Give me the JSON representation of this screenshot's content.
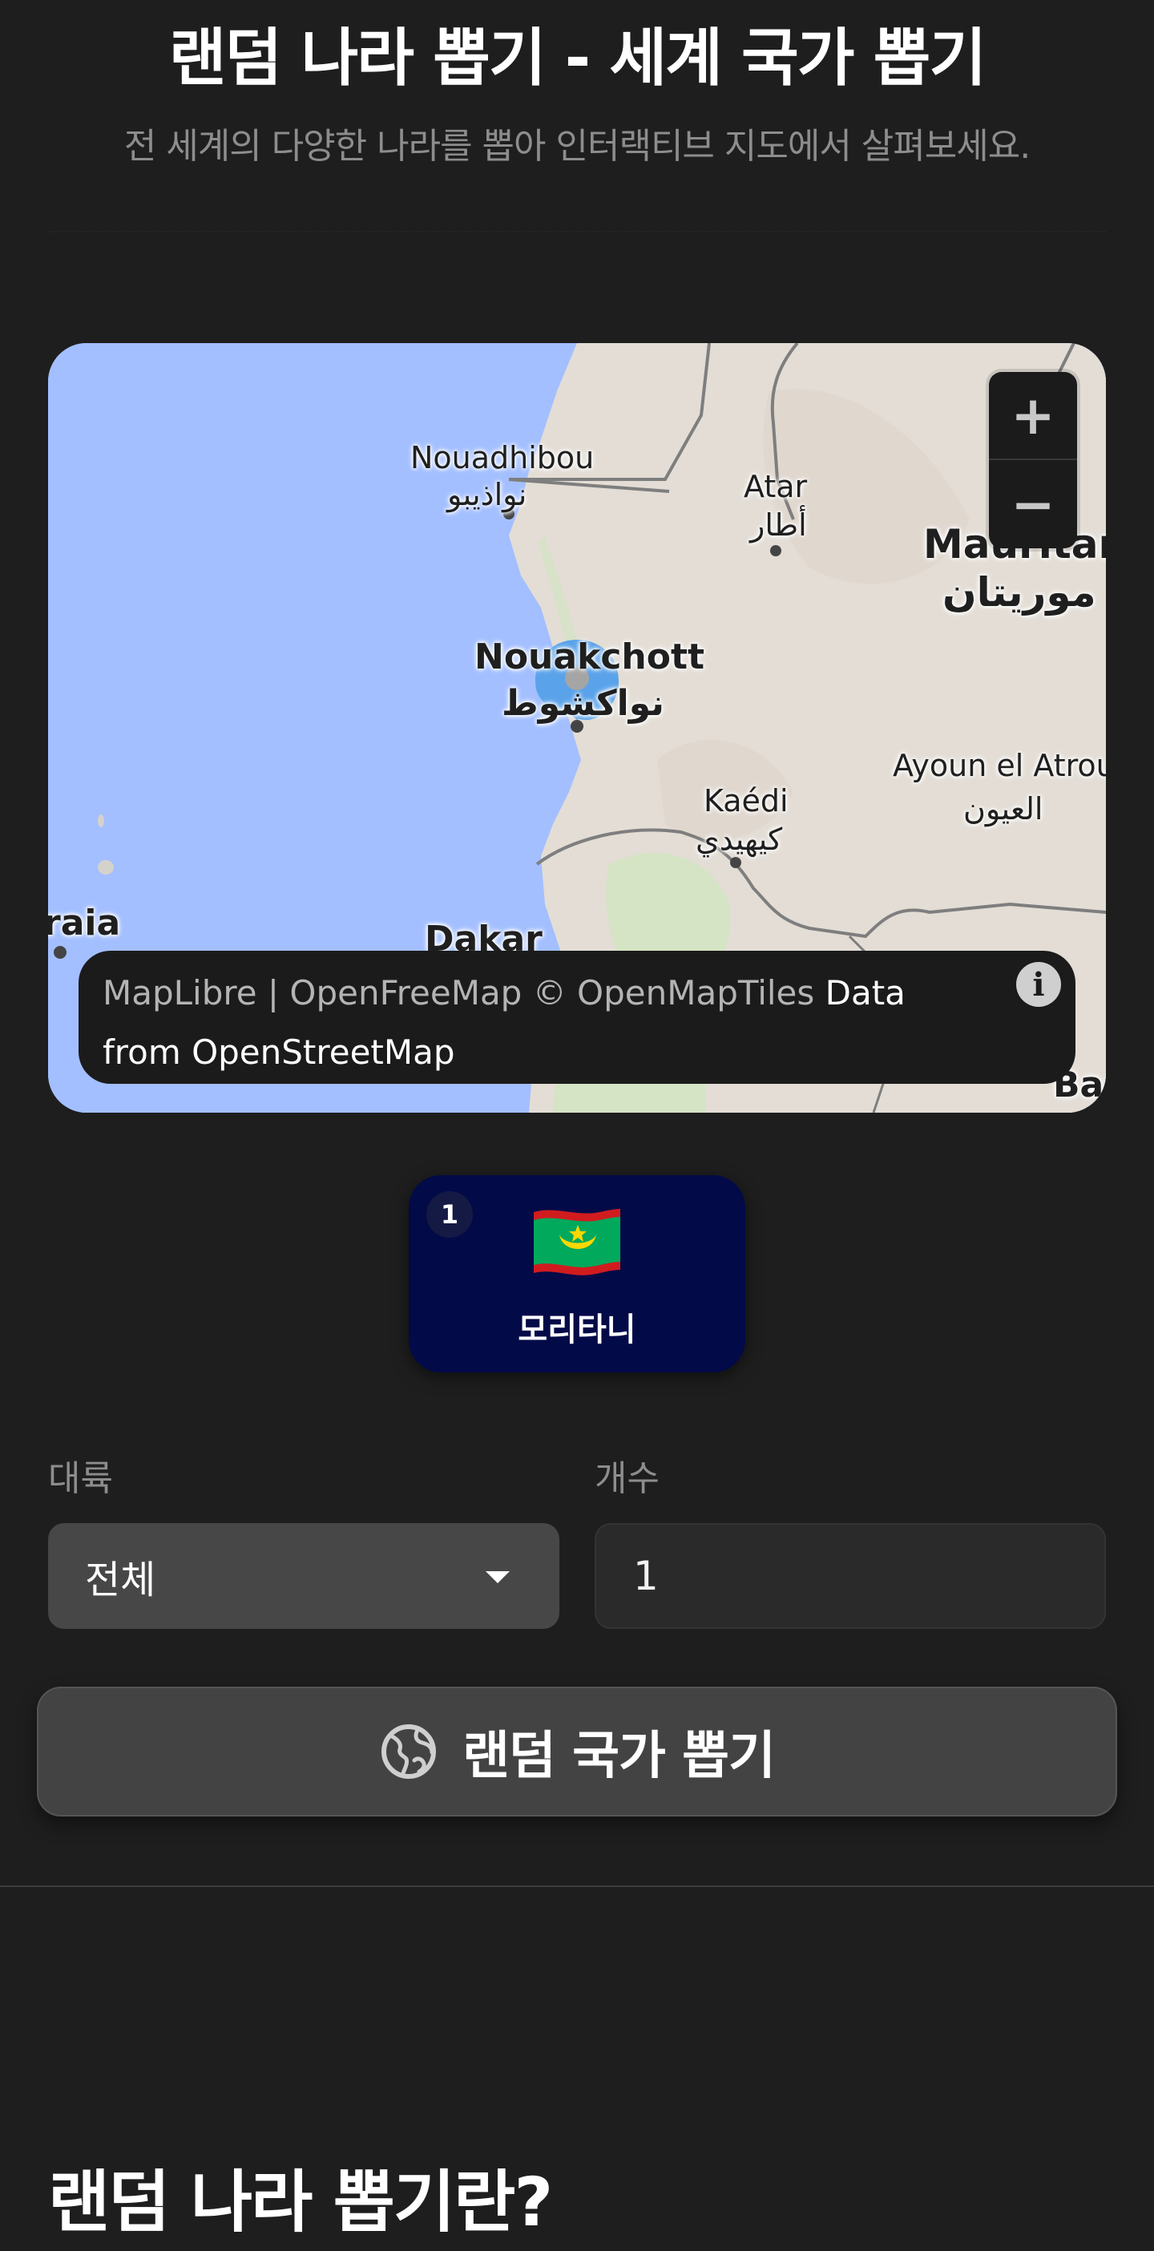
{
  "header": {
    "title": "랜덤 나라 뽑기 - 세계 국가 뽑기",
    "subtitle": "전 세계의 다양한 나라를 뽑아 인터랙티브 지도에서 살펴보세요."
  },
  "map": {
    "labels": {
      "nouadhibou": "Nouadhibou",
      "nouadhibou_ar": "نواذيبو",
      "atar": "Atar",
      "atar_ar": "أطار",
      "mauritania": "Mauritan",
      "mauritania_ar": "موريتان",
      "nouakchott": "Nouakchott",
      "nouakchott_ar": "نواكشوط",
      "ayoun": "Ayoun el Atrou",
      "ayoun_ar": "العيون",
      "kaedi": "Kaédi",
      "kaedi_ar": "كيهيدي",
      "dakar": "Dakar",
      "raia": "raia",
      "bar": "Bar"
    },
    "zoom_in": "+",
    "zoom_out": "−",
    "attribution_part1": "MapLibre | OpenFreeMap © OpenMapTiles",
    "attribution_part2": "Data from OpenStreetMap",
    "info_glyph": "i",
    "colors": {
      "water": "#a3bfff",
      "land": "#e3ddd5",
      "vegetation": "#d4e4c4",
      "marker": "#5aa3ea"
    }
  },
  "result": {
    "index": "1",
    "country": "모리타니",
    "flag": "mauritania-flag"
  },
  "form": {
    "continent_label": "대륙",
    "continent_value": "전체",
    "count_label": "개수",
    "count_value": "1"
  },
  "actions": {
    "draw_label": "랜덤 국가 뽑기",
    "draw_icon": "globe-icon"
  },
  "section": {
    "heading": "랜덤 나라 뽑기란?"
  }
}
